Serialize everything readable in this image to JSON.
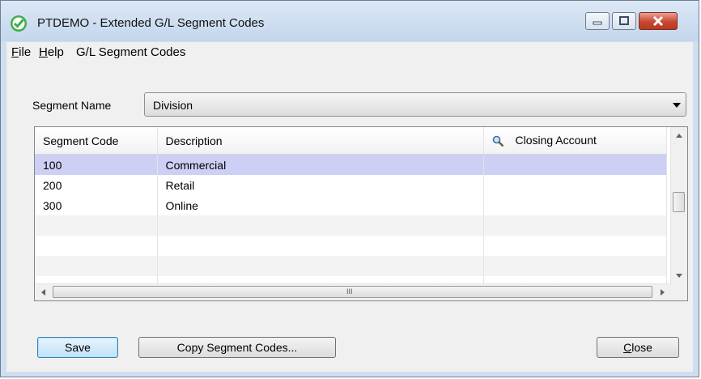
{
  "window": {
    "title": "PTDEMO - Extended G/L Segment Codes"
  },
  "menu": {
    "items": [
      {
        "label": "File",
        "accel": "F",
        "rest": "ile"
      },
      {
        "label": "Help",
        "accel": "H",
        "rest": "elp"
      },
      {
        "label": "G/L Segment Codes"
      }
    ]
  },
  "segment": {
    "label": "Segment Name",
    "value": "Division"
  },
  "grid": {
    "columns": [
      "Segment Code",
      "Description",
      "Closing Account"
    ],
    "rows": [
      {
        "code": "100",
        "description": "Commercial",
        "account": ""
      },
      {
        "code": "200",
        "description": "Retail",
        "account": ""
      },
      {
        "code": "300",
        "description": "Online",
        "account": ""
      },
      {
        "code": "",
        "description": "",
        "account": ""
      },
      {
        "code": "",
        "description": "",
        "account": ""
      },
      {
        "code": "",
        "description": "",
        "account": ""
      },
      {
        "code": "",
        "description": "",
        "account": ""
      }
    ],
    "scroll_grip": "III"
  },
  "buttons": {
    "save": "Save",
    "copy": "Copy Segment Codes...",
    "close_accel": "C",
    "close_rest": "lose"
  },
  "colors": {
    "selected_row": "#cdcff5",
    "close_button": "#c9472f"
  }
}
